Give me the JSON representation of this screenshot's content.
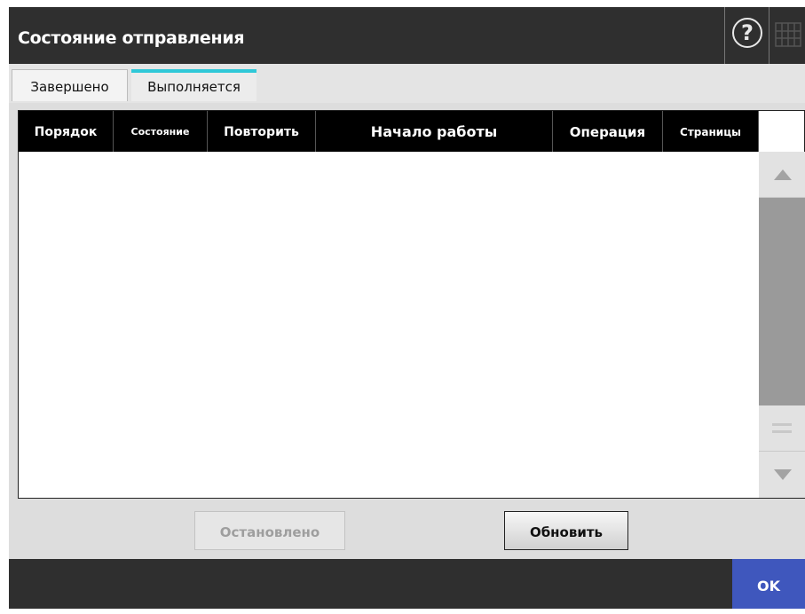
{
  "window": {
    "title": "Состояние отправления"
  },
  "toolbar": {
    "help_icon": "question-circle",
    "keyboard_icon": "keyboard"
  },
  "tabs": [
    {
      "label": "Завершено",
      "selected": false
    },
    {
      "label": "Выполняется",
      "selected": true
    }
  ],
  "table": {
    "columns": [
      "Порядок",
      "Состояние",
      "Повторить",
      "Начало работы",
      "Операция",
      "Страницы"
    ],
    "rows": []
  },
  "buttons": {
    "stopped_label": "Остановлено",
    "refresh_label": "Обновить",
    "ok_label": "OK"
  },
  "colors": {
    "accent": "#2fc8d8",
    "ok": "#3f57bd",
    "bar": "#2f2f2f"
  }
}
